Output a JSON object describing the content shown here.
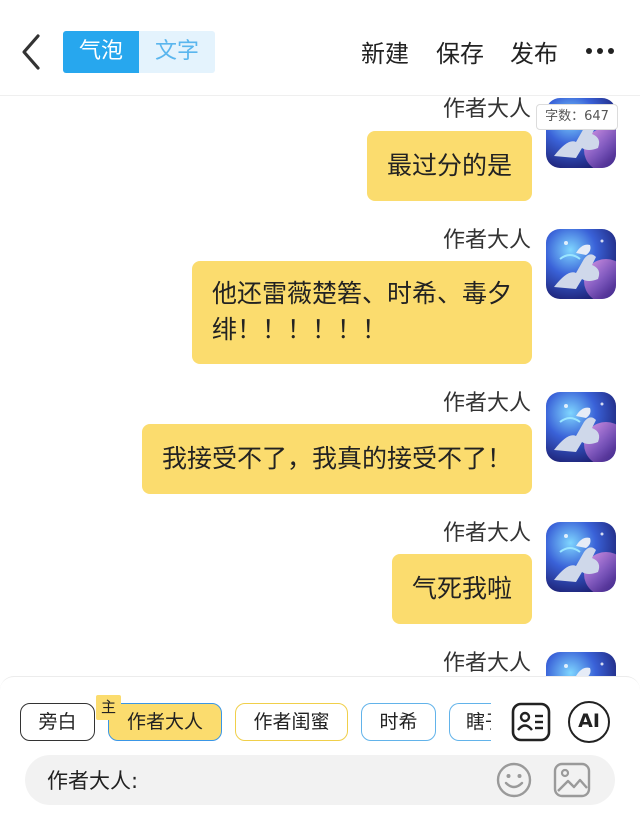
{
  "header": {
    "tabs": [
      "气泡",
      "文字"
    ],
    "actions": [
      "新建",
      "保存",
      "发布"
    ]
  },
  "word_count": "字数：647",
  "messages": [
    {
      "speaker": "作者大人",
      "lines": [
        "最过分的是"
      ]
    },
    {
      "speaker": "作者大人",
      "lines": [
        "他还雷薇楚箬、时希、毒夕",
        "绯！！！！！！"
      ]
    },
    {
      "speaker": "作者大人",
      "lines": [
        "我接受不了，我真的接受不了！"
      ]
    },
    {
      "speaker": "作者大人",
      "lines": [
        "气死我啦"
      ]
    },
    {
      "speaker": "作者大人",
      "lines": []
    }
  ],
  "characters": {
    "narration": "旁白",
    "main_badge": "主",
    "selected": "作者大人",
    "items": [
      "作者闺蜜",
      "时希",
      "瞎子"
    ]
  },
  "tools": {
    "ai_label": "AI"
  },
  "input": {
    "speaker_prefix": "作者大人:"
  },
  "colors": {
    "accent": "#27a7ee",
    "bubble": "#fbdc6e"
  }
}
